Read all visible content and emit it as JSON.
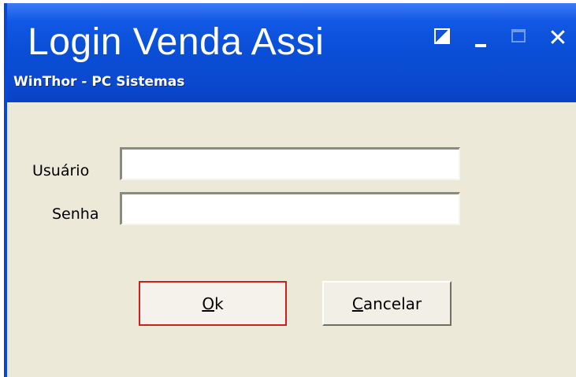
{
  "window": {
    "title": "Login Venda Assi",
    "subtitle": "WinThor - PC Sistemas",
    "buttons": {
      "custom_icon": "custom-icon",
      "minimize_icon": "minimize-icon",
      "maximize_icon": "maximize-icon",
      "close_glyph": "✕"
    }
  },
  "form": {
    "user_label": "Usuário",
    "user_value": "",
    "password_label": "Senha",
    "password_value": ""
  },
  "actions": {
    "ok_mnemonic": "O",
    "ok_rest": "k",
    "cancel_mnemonic": "C",
    "cancel_rest": "ancelar"
  },
  "colors": {
    "titlebar": "#0a4fd7",
    "highlight_border": "#d01f1f",
    "window_bg": "#ece9d8"
  }
}
